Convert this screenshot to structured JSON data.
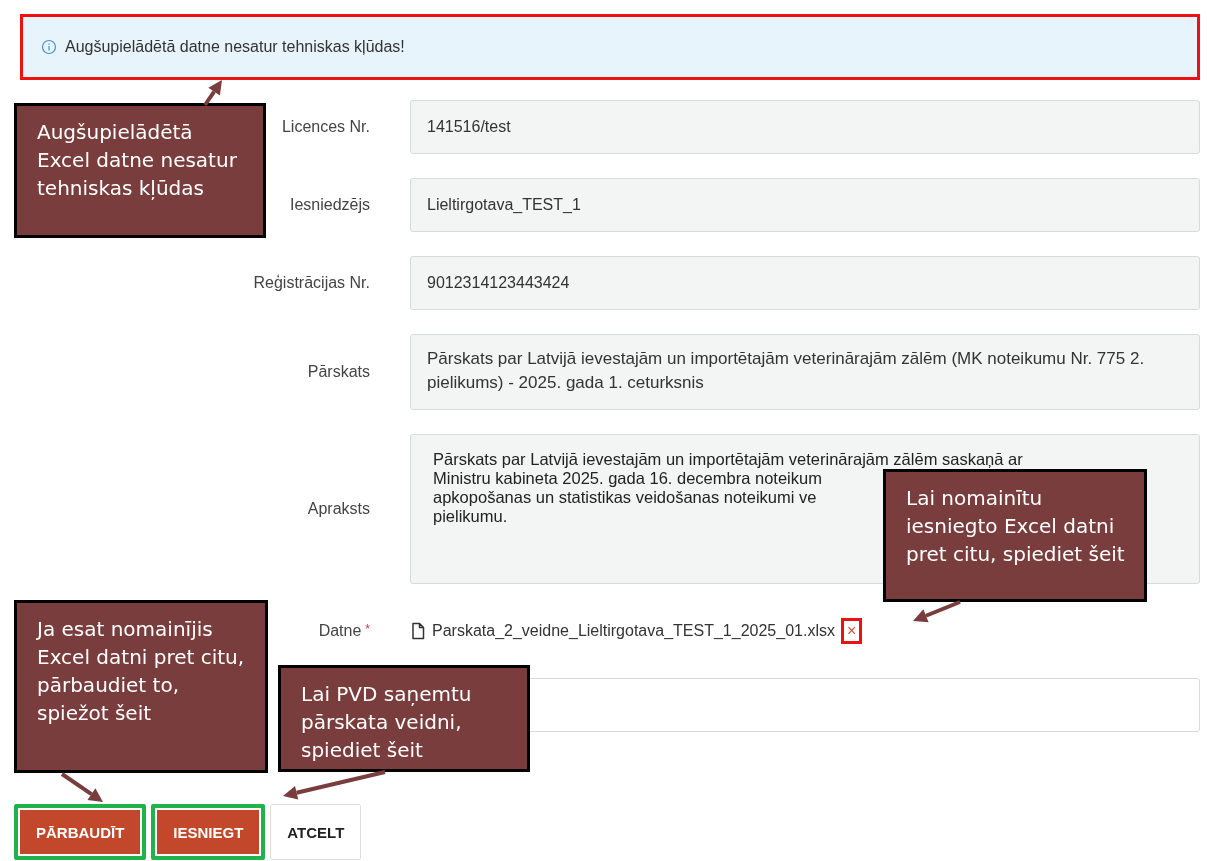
{
  "alert": {
    "text": "Augšupielādētā datne nesatur tehniskas kļūdas!",
    "highlight": true
  },
  "fields": [
    {
      "kind": "input",
      "label": "Licences Nr.",
      "value": "141516/test"
    },
    {
      "kind": "input",
      "label": "Iesniedzējs",
      "value": "Lieltirgotava_TEST_1"
    },
    {
      "kind": "input",
      "label": "Reģistrācijas Nr.",
      "value": "9012314123443424"
    },
    {
      "kind": "textarea",
      "label": "Pārskats",
      "value": "Pārskats par Latvijā ievestajām un importētajām veterinārajām zālēm (MK noteikumu Nr. 775 2. pielikums) - 2025. gada 1. ceturksnis"
    },
    {
      "kind": "lines",
      "label": "Apraksts",
      "lines": [
        "Pārskats par Latvijā ievestajām un importētajām veterinārajām zālēm saskaņā ar",
        "Ministru kabineta 2025. gada 16. decembra noteikum",
        "apkopošanas un statistikas veidošanas noteikumi ve",
        "pielikumu."
      ]
    },
    {
      "kind": "file",
      "label": "Datne",
      "required": true,
      "required_mark": "*",
      "filename": "Parskata_2_veidne_Lieltirgotava_TEST_1_2025_01.xlsx",
      "remove": "×",
      "remove_highlight": true
    },
    {
      "kind": "blank"
    }
  ],
  "buttons": [
    {
      "label": "PĀRBAUDĪT",
      "primary": true,
      "highlight": true
    },
    {
      "label": "IESNIEGT",
      "primary": true,
      "highlight": true
    },
    {
      "label": "ATCELT",
      "primary": false,
      "highlight": false
    }
  ],
  "callouts": [
    {
      "text": "Augšupielādētā Excel datne nesatur tehniskas kļūdas"
    },
    {
      "text": "Lai nomainītu iesniegto Excel datni pret citu, spiediet šeit"
    },
    {
      "text": "Ja esat nomainījis Excel datni pret citu, pārbaudiet to, spiežot šeit"
    },
    {
      "text": "Lai PVD saņemtu pārskata veidni, spiediet šeit"
    }
  ]
}
